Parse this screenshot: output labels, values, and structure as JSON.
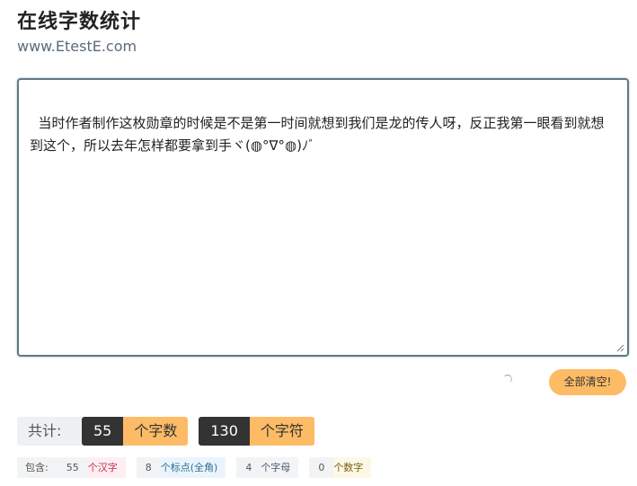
{
  "header": {
    "title": "在线字数统计",
    "url": "www.EtestE.com"
  },
  "editor": {
    "text": "当时作者制作这枚勋章的时候是不是第一时间就想到我们是龙的传人呀，反正我第一眼看到就想到这个，所以去年怎样都要拿到手ヾ(◍°∇°◍)ﾉﾞ"
  },
  "actions": {
    "clear_all_label": "全部清空!"
  },
  "totals": {
    "label": "共计:",
    "words_value": "55",
    "words_unit": "个字数",
    "chars_value": "130",
    "chars_unit": "个字符"
  },
  "details": {
    "label": "包含:",
    "items": [
      {
        "value": "55",
        "unit": "个汉字",
        "color": "#c0304a"
      },
      {
        "value": "8",
        "unit": "个标点(全角)",
        "color": "#2f6f96"
      },
      {
        "value": "4",
        "unit": "个字母",
        "color": "#4a5a6a"
      },
      {
        "value": "0",
        "unit": "个数字",
        "color": "#7a5a10"
      }
    ]
  },
  "colors": {
    "accent": "#fdbb66",
    "dark": "#333333",
    "border": "#5f7a80"
  }
}
